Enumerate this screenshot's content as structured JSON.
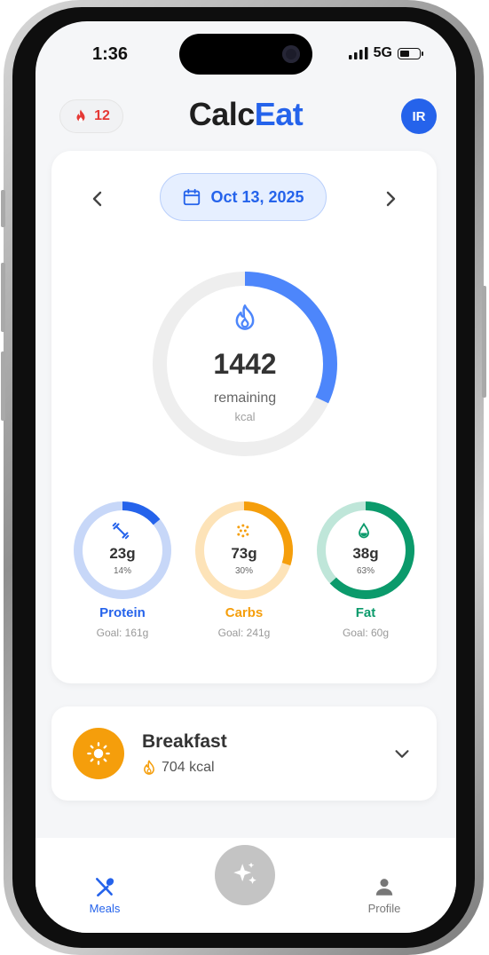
{
  "status": {
    "time": "1:36",
    "network": "5G"
  },
  "header": {
    "streak_count": "12",
    "logo_part1": "Calc",
    "logo_part2": "Eat",
    "avatar_initials": "IR"
  },
  "date": {
    "label": "Oct 13, 2025"
  },
  "calories": {
    "remaining": "1442",
    "remaining_label": "remaining",
    "unit": "kcal",
    "progress": 0.32
  },
  "macros": [
    {
      "name": "Protein",
      "value": "23g",
      "percent": "14%",
      "goal": "Goal: 161g",
      "progress": 0.14,
      "color": "#2563eb",
      "track": "#c7d7f8"
    },
    {
      "name": "Carbs",
      "value": "73g",
      "percent": "30%",
      "goal": "Goal: 241g",
      "progress": 0.3,
      "color": "#f59e0b",
      "track": "#fde3b8"
    },
    {
      "name": "Fat",
      "value": "38g",
      "percent": "63%",
      "goal": "Goal: 60g",
      "progress": 0.63,
      "color": "#0b9a6b",
      "track": "#bfe6d9"
    }
  ],
  "meal": {
    "title": "Breakfast",
    "kcal": "704 kcal"
  },
  "tabs": {
    "meals": "Meals",
    "profile": "Profile"
  },
  "colors": {
    "accent": "#2563eb",
    "main_ring": "#4d86fb",
    "ring_track": "#eeeeee"
  }
}
